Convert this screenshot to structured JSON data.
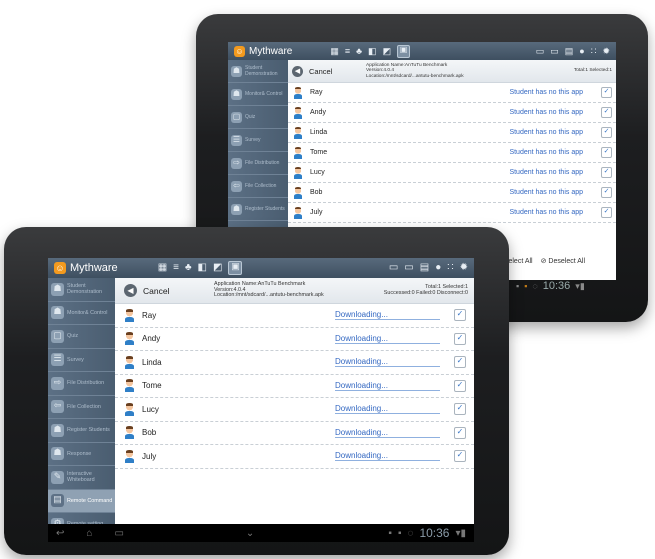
{
  "app_name": "Mythware",
  "app_info": {
    "name": "Application Name:AnTuTu Benchmark",
    "version": "Version:4.0.4",
    "location": "Location:/mnt/sdcard/...antutu-benchmark.apk"
  },
  "cancel_label": "Cancel",
  "back_tablet": {
    "stats": "Total:1  Selected:1",
    "students": [
      {
        "name": "Ray",
        "status": "Student has no this app"
      },
      {
        "name": "Andy",
        "status": "Student has no this app"
      },
      {
        "name": "Linda",
        "status": "Student has no this app"
      },
      {
        "name": "Tome",
        "status": "Student has no this app"
      },
      {
        "name": "Lucy",
        "status": "Student has no this app"
      },
      {
        "name": "Bob",
        "status": "Student has no this app"
      },
      {
        "name": "July",
        "status": "Student has no this app"
      }
    ],
    "select_all": "Select All",
    "deselect_all": "Deselect All",
    "clock": "10:36"
  },
  "front_tablet": {
    "stats_line1": "Total:1  Selected:1",
    "stats_line2": "Successed:0  Failed:0  Disconnect:0",
    "students": [
      {
        "name": "Ray",
        "status": "Downloading..."
      },
      {
        "name": "Andy",
        "status": "Downloading..."
      },
      {
        "name": "Linda",
        "status": "Downloading..."
      },
      {
        "name": "Tome",
        "status": "Downloading..."
      },
      {
        "name": "Lucy",
        "status": "Downloading..."
      },
      {
        "name": "Bob",
        "status": "Downloading..."
      },
      {
        "name": "July",
        "status": "Downloading..."
      }
    ],
    "clock": "10:36"
  },
  "sidebar": [
    {
      "label": "Student Demonstration",
      "icon": "person-icon"
    },
    {
      "label": "Monitor& Control",
      "icon": "monitor-icon"
    },
    {
      "label": "Quiz",
      "icon": "quiz-icon"
    },
    {
      "label": "Survey",
      "icon": "survey-icon"
    },
    {
      "label": "File Distribution",
      "icon": "file-distribution-icon"
    },
    {
      "label": "File Collection",
      "icon": "file-collection-icon"
    },
    {
      "label": "Register Students",
      "icon": "register-icon"
    },
    {
      "label": "Response",
      "icon": "response-icon"
    },
    {
      "label": "Interactive Whiteboard",
      "icon": "whiteboard-icon"
    },
    {
      "label": "Remote Command",
      "icon": "remote-command-icon"
    },
    {
      "label": "Remote setting",
      "icon": "settings-icon"
    }
  ],
  "colors": {
    "accent": "#3569c2",
    "topbar": "#4b5d6f",
    "logo": "#f39a1e"
  }
}
